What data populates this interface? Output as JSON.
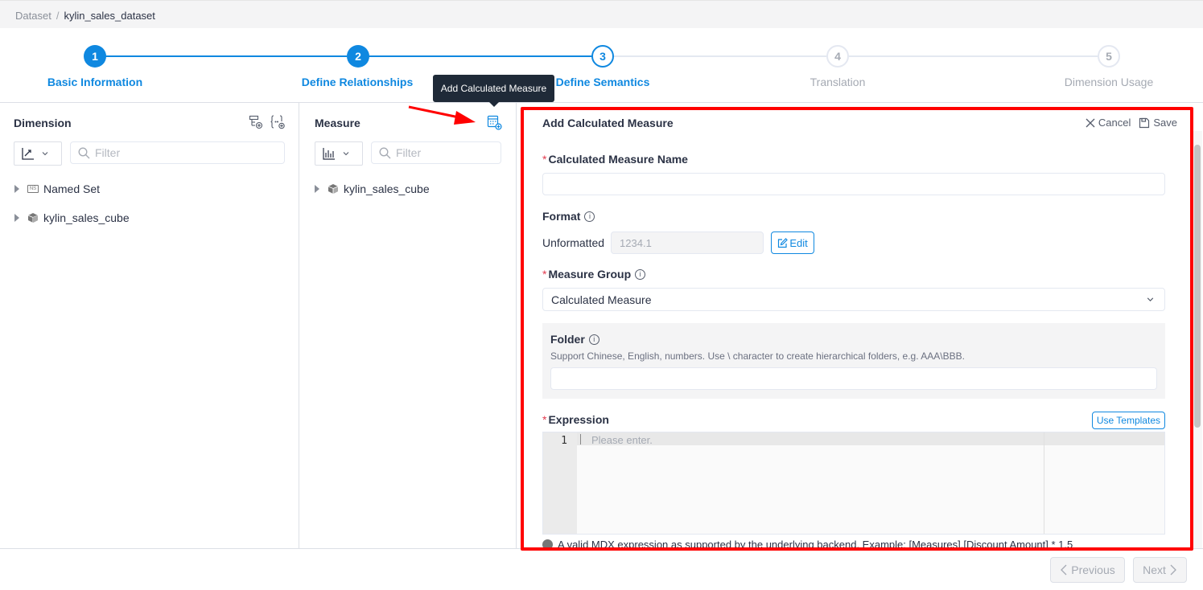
{
  "breadcrumb": {
    "root": "Dataset",
    "separator": "/",
    "current": "kylin_sales_dataset"
  },
  "steps": [
    {
      "number": "1",
      "label": "Basic Information",
      "state": "done"
    },
    {
      "number": "2",
      "label": "Define Relationships",
      "state": "done"
    },
    {
      "number": "3",
      "label": "Define Semantics",
      "state": "active"
    },
    {
      "number": "4",
      "label": "Translation",
      "state": "pending"
    },
    {
      "number": "5",
      "label": "Dimension Usage",
      "state": "pending"
    }
  ],
  "tooltip": {
    "text": "Add Calculated Measure"
  },
  "dimension_panel": {
    "title": "Dimension",
    "actions": [
      {
        "icon": "add-hierarchy-icon"
      },
      {
        "icon": "add-named-set-icon"
      }
    ],
    "type_select_icon": "line-chart-icon",
    "filter_placeholder": "Filter",
    "tree": [
      {
        "label": "Named Set",
        "icon": "named-set-icon",
        "badge": "NS"
      },
      {
        "label": "kylin_sales_cube",
        "icon": "cube-icon"
      }
    ]
  },
  "measure_panel": {
    "title": "Measure",
    "actions": [
      {
        "icon": "add-calculated-measure-icon"
      }
    ],
    "type_select_icon": "bar-chart-icon",
    "filter_placeholder": "Filter",
    "tree": [
      {
        "label": "kylin_sales_cube",
        "icon": "cube-icon"
      }
    ]
  },
  "form": {
    "title": "Add Calculated Measure",
    "cancel_label": "Cancel",
    "save_label": "Save",
    "name_field": {
      "label": "Calculated Measure Name",
      "required": true,
      "value": ""
    },
    "format": {
      "label": "Format",
      "type_label": "Unformatted",
      "preview": "1234.1",
      "edit_label": "Edit"
    },
    "measure_group": {
      "label": "Measure Group",
      "required": true,
      "selected": "Calculated Measure"
    },
    "folder": {
      "label": "Folder",
      "hint": "Support Chinese, English, numbers. Use \\ character to create hierarchical folders, e.g. AAA\\BBB.",
      "value": ""
    },
    "expression": {
      "label": "Expression",
      "required": true,
      "templates_label": "Use Templates",
      "line_number": "1",
      "placeholder": "Please enter.",
      "hint": "A valid  MDX expression as supported by the underlying backend. Example: [Measures].[Discount Amount] * 1.5"
    }
  },
  "footer": {
    "previous_label": "Previous",
    "next_label": "Next"
  },
  "colors": {
    "primary": "#0f88e0",
    "annotation": "#ff0000",
    "tooltip_bg": "#1f2a38",
    "required": "#e23a4e"
  }
}
